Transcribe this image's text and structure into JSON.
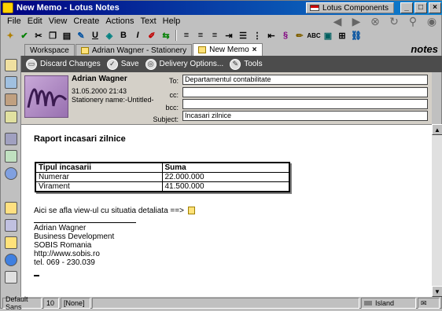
{
  "window": {
    "title": "New Memo - Lotus Notes",
    "location": "Lotus Components",
    "min": "_",
    "max": "□",
    "close": "×"
  },
  "menu": [
    "File",
    "Edit",
    "View",
    "Create",
    "Actions",
    "Text",
    "Help"
  ],
  "tabs": [
    {
      "label": "Workspace",
      "active": false
    },
    {
      "label": "Adrian Wagner - Stationery",
      "active": false
    },
    {
      "label": "New Memo",
      "active": true
    }
  ],
  "brand": "notes",
  "actions": [
    {
      "label": "Discard Changes",
      "icon": "discard-icon"
    },
    {
      "label": "Save",
      "icon": "save-icon"
    },
    {
      "label": "Delivery Options...",
      "icon": "delivery-icon"
    },
    {
      "label": "Tools",
      "icon": "tools-icon"
    }
  ],
  "header": {
    "author": "Adrian Wagner",
    "date": "31.05.2000 21:43",
    "stationery": "Stationery name:-Untitled-",
    "fields": {
      "to": {
        "label": "To:",
        "value": "Departamentul contabilitate"
      },
      "cc": {
        "label": "cc:",
        "value": ""
      },
      "bcc": {
        "label": "bcc:",
        "value": ""
      },
      "subject": {
        "label": "Subject:",
        "value": "Incasari zilnice"
      }
    }
  },
  "body": {
    "heading": "Raport incasari zilnice",
    "table": {
      "headers": [
        "Tipul incasarii",
        "Suma"
      ],
      "rows": [
        [
          "Numerar",
          "22.000.000"
        ],
        [
          "Virament",
          "41.500.000"
        ]
      ]
    },
    "link_text": "Aici se afla view-ul cu situatia detaliata ==>",
    "signature": [
      "Adrian Wagner",
      "Business Development",
      "SOBIS Romania",
      "http://www.sobis.ro",
      "tel. 069 - 230.039"
    ]
  },
  "status": {
    "font": "Default Sans",
    "size": "10",
    "style": "[None]",
    "location": "Island"
  },
  "colors": {
    "titlebar": "#000080",
    "actionbar": "#4c4c4c",
    "header_bg": "#d4d0c8"
  }
}
